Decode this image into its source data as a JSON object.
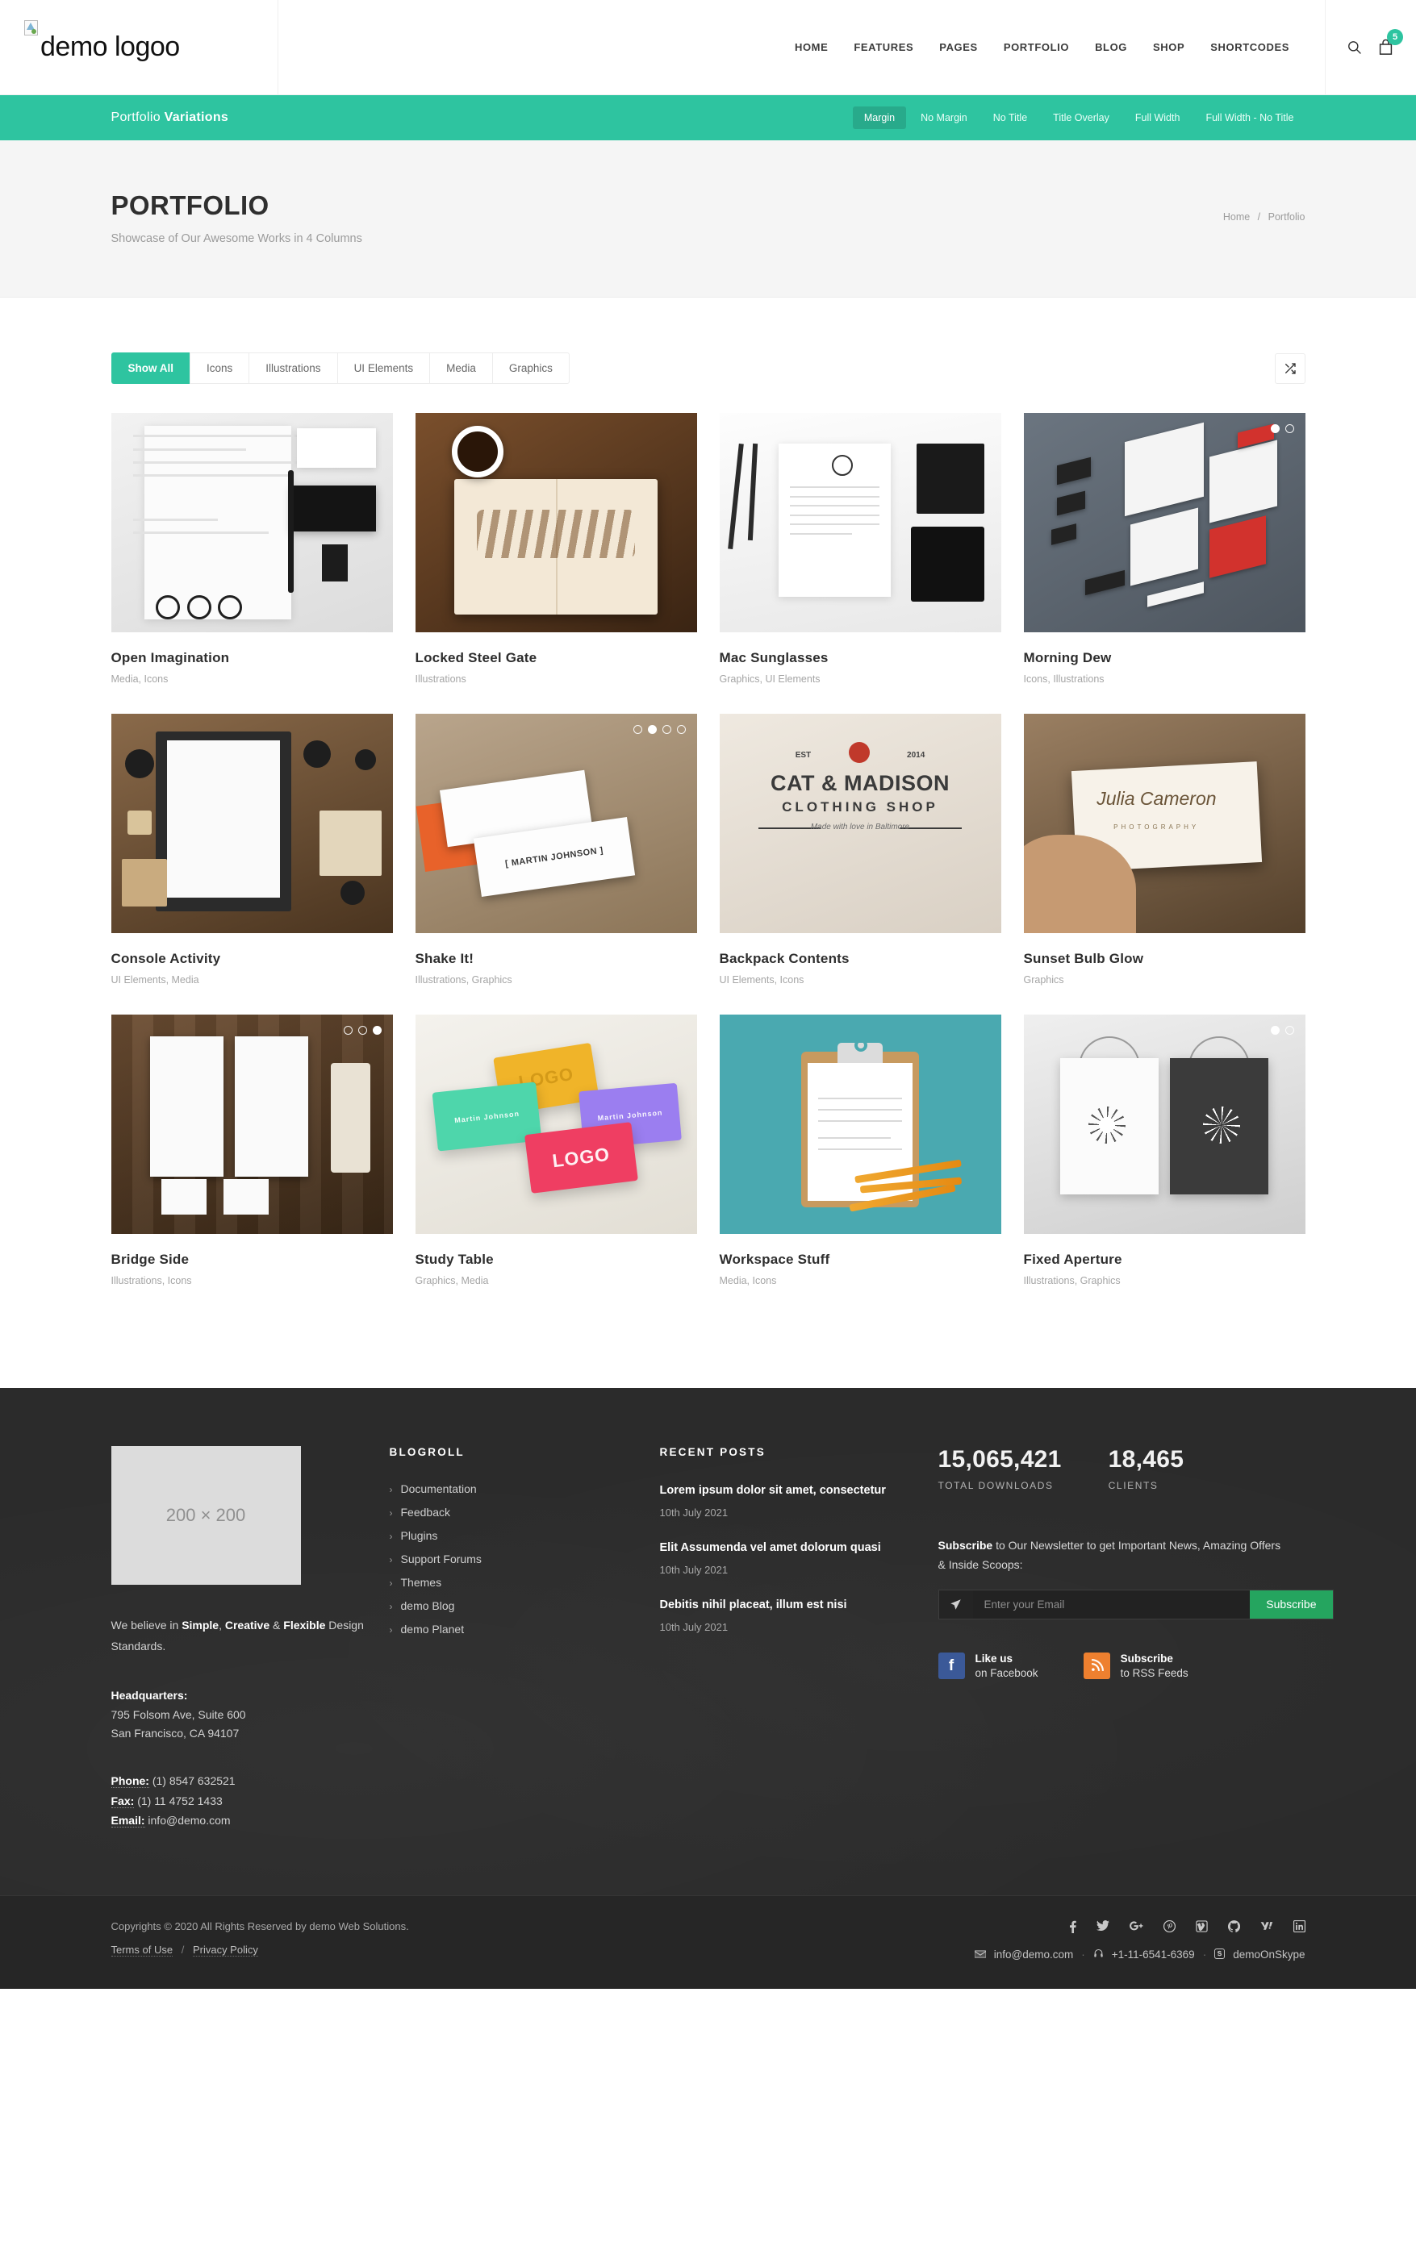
{
  "header": {
    "logo_alt": "demo logoo",
    "nav": [
      {
        "label": "HOME"
      },
      {
        "label": "FEATURES"
      },
      {
        "label": "PAGES"
      },
      {
        "label": "PORTFOLIO"
      },
      {
        "label": "BLOG"
      },
      {
        "label": "SHOP"
      },
      {
        "label": "SHORTCODES"
      }
    ],
    "search_icon": "search-icon",
    "cart_icon": "cart-icon",
    "cart_count": "5"
  },
  "subnav": {
    "title_light": "Portfolio ",
    "title_bold": "Variations",
    "links": [
      {
        "label": "Margin",
        "active": true
      },
      {
        "label": "No Margin",
        "active": false
      },
      {
        "label": "No Title",
        "active": false
      },
      {
        "label": "Title Overlay",
        "active": false
      },
      {
        "label": "Full Width",
        "active": false
      },
      {
        "label": "Full Width - No Title",
        "active": false
      }
    ]
  },
  "page_title": {
    "heading": "PORTFOLIO",
    "subtitle": "Showcase of Our Awesome Works in 4 Columns",
    "breadcrumb_home": "Home",
    "breadcrumb_sep": "/",
    "breadcrumb_current": "Portfolio"
  },
  "filters": {
    "items": [
      {
        "label": "Show All",
        "active": true
      },
      {
        "label": "Icons",
        "active": false
      },
      {
        "label": "Illustrations",
        "active": false
      },
      {
        "label": "UI Elements",
        "active": false
      },
      {
        "label": "Media",
        "active": false
      },
      {
        "label": "Graphics",
        "active": false
      }
    ],
    "shuffle_icon": "shuffle-icon"
  },
  "portfolio": {
    "items": [
      {
        "title": "Open Imagination",
        "cats": "Media, Icons",
        "dots": 0,
        "dot_active": -1
      },
      {
        "title": "Locked Steel Gate",
        "cats": "Illustrations",
        "dots": 0,
        "dot_active": -1
      },
      {
        "title": "Mac Sunglasses",
        "cats": "Graphics, UI Elements",
        "dots": 0,
        "dot_active": -1
      },
      {
        "title": "Morning Dew",
        "cats": "Icons, Illustrations",
        "dots": 2,
        "dot_active": 0
      },
      {
        "title": "Console Activity",
        "cats": "UI Elements, Media",
        "dots": 0,
        "dot_active": -1
      },
      {
        "title": "Shake It!",
        "cats": "Illustrations, Graphics",
        "dots": 4,
        "dot_active": 1
      },
      {
        "title": "Backpack Contents",
        "cats": "UI Elements, Icons",
        "dots": 0,
        "dot_active": -1
      },
      {
        "title": "Sunset Bulb Glow",
        "cats": "Graphics",
        "dots": 0,
        "dot_active": -1
      },
      {
        "title": "Bridge Side",
        "cats": "Illustrations, Icons",
        "dots": 3,
        "dot_active": 2
      },
      {
        "title": "Study Table",
        "cats": "Graphics, Media",
        "dots": 0,
        "dot_active": -1
      },
      {
        "title": "Workspace Stuff",
        "cats": "Media, Icons",
        "dots": 0,
        "dot_active": -1
      },
      {
        "title": "Fixed Aperture",
        "cats": "Illustrations, Graphics",
        "dots": 2,
        "dot_active": 0
      }
    ],
    "thumb_art": {
      "cat_madison_est": "EST",
      "cat_madison_year": "2014",
      "cat_madison_l1": "CAT & MADISON",
      "cat_madison_l2": "CLOTHING SHOP",
      "cat_madison_l3": "Made with love in Baltimore",
      "sunset_script": "Julia Cameron",
      "sunset_sub": "PHOTOGRAPHY",
      "study_logo": "LOGO",
      "study_name": "Martin Johnson",
      "shake_name": "[ MARTIN JOHNSON ]"
    }
  },
  "footer": {
    "placeholder_image": "200 × 200",
    "blurb_pre": "We believe in ",
    "blurb_b1": "Simple",
    "blurb_mid1": ", ",
    "blurb_b2": "Creative",
    "blurb_mid2": " & ",
    "blurb_b3": "Flexible",
    "blurb_post": " Design Standards.",
    "hq_label": "Headquarters:",
    "address_line1": "795 Folsom Ave, Suite 600",
    "address_line2": "San Francisco, CA 94107",
    "phone_label": "Phone:",
    "phone_value": "(1) 8547 632521",
    "fax_label": "Fax:",
    "fax_value": "(1) 11 4752 1433",
    "email_label": "Email:",
    "email_value": "info@demo.com",
    "blogroll_title": "BLOGROLL",
    "blogroll": [
      {
        "label": "Documentation"
      },
      {
        "label": "Feedback"
      },
      {
        "label": "Plugins"
      },
      {
        "label": "Support Forums"
      },
      {
        "label": "Themes"
      },
      {
        "label": "demo Blog"
      },
      {
        "label": "demo Planet"
      }
    ],
    "recent_title": "RECENT POSTS",
    "recent_posts": [
      {
        "title": "Lorem ipsum dolor sit amet, consectetur",
        "date": "10th July 2021"
      },
      {
        "title": "Elit Assumenda vel amet dolorum quasi",
        "date": "10th July 2021"
      },
      {
        "title": "Debitis nihil placeat, illum est nisi",
        "date": "10th July 2021"
      }
    ],
    "stats": [
      {
        "number": "15,065,421",
        "label": "TOTAL DOWNLOADS"
      },
      {
        "number": "18,465",
        "label": "CLIENTS"
      }
    ],
    "newsletter_bold": "Subscribe",
    "newsletter_rest": " to Our Newsletter to get Important News, Amazing Offers & Inside Scoops:",
    "newsletter_placeholder": "Enter your Email",
    "newsletter_button": "Subscribe",
    "newsletter_icon": "paper-plane-icon",
    "facebook_t1": "Like us",
    "facebook_t2": "on Facebook",
    "rss_t1": "Subscribe",
    "rss_t2": "to RSS Feeds"
  },
  "footer_bottom": {
    "copyright": "Copyrights © 2020 All Rights Reserved by demo Web Solutions.",
    "terms": "Terms of Use",
    "legal_sep": "/",
    "privacy": "Privacy Policy",
    "social": [
      {
        "name": "facebook-icon",
        "glyph": "f"
      },
      {
        "name": "twitter-icon",
        "glyph": "🐦"
      },
      {
        "name": "google-plus-icon",
        "glyph": "g+"
      },
      {
        "name": "pinterest-icon",
        "glyph": "P"
      },
      {
        "name": "vimeo-icon",
        "glyph": "v"
      },
      {
        "name": "github-icon",
        "glyph": "◎"
      },
      {
        "name": "yahoo-icon",
        "glyph": "y!"
      },
      {
        "name": "linkedin-icon",
        "glyph": "in"
      }
    ],
    "email_icon": "envelope-icon",
    "email": "info@demo.com",
    "sep1": "·",
    "phone_icon": "headphone-icon",
    "phone": "+1-11-6541-6369",
    "sep2": "·",
    "skype_icon": "skype-icon",
    "skype": "demoOnSkype"
  },
  "colors": {
    "accent": "#2ec4a0",
    "subscribe_green": "#25a55f",
    "footer_bg": "#2b2b2b",
    "facebook_blue": "#3b5998",
    "rss_orange": "#ee802f"
  }
}
